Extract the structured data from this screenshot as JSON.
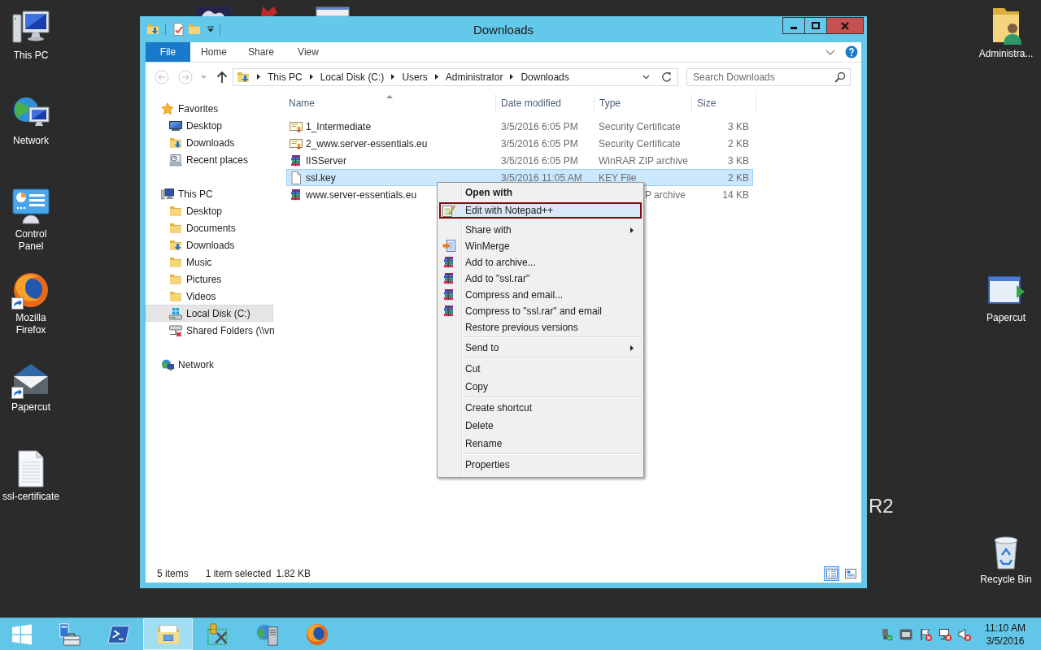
{
  "desktop": {
    "left_icons": [
      {
        "label": "This PC",
        "kind": "computer",
        "shortcut": false
      },
      {
        "label": "Network",
        "kind": "network",
        "shortcut": false
      },
      {
        "label": "Control Panel",
        "kind": "control-panel",
        "shortcut": false
      },
      {
        "label": "Mozilla Firefox",
        "kind": "browser",
        "shortcut": true
      },
      {
        "label": "Papercut",
        "kind": "mail",
        "shortcut": true
      },
      {
        "label": "ssl-certificate",
        "kind": "document",
        "shortcut": false
      }
    ],
    "right_icons": [
      {
        "label": "Administra...",
        "kind": "user-folder",
        "shortcut": false
      },
      {
        "label": "Papercut",
        "kind": "app-window",
        "shortcut": false
      },
      {
        "label": "Recycle Bin",
        "kind": "recycle-bin",
        "shortcut": false
      }
    ],
    "edition_text": "R2"
  },
  "window": {
    "title": "Downloads",
    "ribbon_tabs": [
      {
        "label": "File",
        "kind": "file",
        "selected": false
      },
      {
        "label": "Home",
        "kind": "tab",
        "selected": false
      },
      {
        "label": "Share",
        "kind": "tab",
        "selected": false
      },
      {
        "label": "View",
        "kind": "tab",
        "selected": false
      }
    ],
    "address": {
      "crumbs": [
        "This PC",
        "Local Disk (C:)",
        "Users",
        "Administrator",
        "Downloads"
      ]
    },
    "search": {
      "placeholder": "Search Downloads"
    },
    "nav": [
      {
        "label": "Favorites",
        "kind": "star",
        "selected": false,
        "children": [
          {
            "label": "Desktop",
            "kind": "monitor",
            "selected": false
          },
          {
            "label": "Downloads",
            "kind": "download-folder",
            "selected": false
          },
          {
            "label": "Recent places",
            "kind": "recent",
            "selected": false
          }
        ]
      },
      {
        "label": "This PC",
        "kind": "computer",
        "selected": false,
        "children": [
          {
            "label": "Desktop",
            "kind": "folder",
            "selected": false
          },
          {
            "label": "Documents",
            "kind": "folder",
            "selected": false
          },
          {
            "label": "Downloads",
            "kind": "download-folder",
            "selected": false
          },
          {
            "label": "Music",
            "kind": "folder",
            "selected": false
          },
          {
            "label": "Pictures",
            "kind": "folder",
            "selected": false
          },
          {
            "label": "Videos",
            "kind": "folder",
            "selected": false
          },
          {
            "label": "Local Disk (C:)",
            "kind": "drive",
            "selected": true
          },
          {
            "label": "Shared Folders (\\\\vn",
            "kind": "network-drive",
            "selected": false
          }
        ]
      },
      {
        "label": "Network",
        "kind": "network",
        "selected": false
      }
    ],
    "columns": [
      {
        "label": "Name",
        "sorted": true
      },
      {
        "label": "Date modified",
        "sorted": false
      },
      {
        "label": "Type",
        "sorted": false
      },
      {
        "label": "Size",
        "sorted": false
      }
    ],
    "files": [
      {
        "name": "1_Intermediate",
        "date": "3/5/2016 6:05 PM",
        "type": "Security Certificate",
        "size": "3 KB",
        "kind": "certificate",
        "selected": false,
        "covered": false
      },
      {
        "name": "2_www.server-essentials.eu",
        "date": "3/5/2016 6:05 PM",
        "type": "Security Certificate",
        "size": "2 KB",
        "kind": "certificate",
        "selected": false,
        "covered": false
      },
      {
        "name": "IISServer",
        "date": "3/5/2016 6:05 PM",
        "type": "WinRAR ZIP archive",
        "size": "3 KB",
        "kind": "archive",
        "selected": false,
        "covered": false
      },
      {
        "name": "ssl.key",
        "date": "3/5/2016 11:05 AM",
        "type": "KEY File",
        "size": "2 KB",
        "kind": "file",
        "selected": true,
        "covered": false
      },
      {
        "name": "www.server-essentials.eu",
        "type": "P archive",
        "size": "14 KB",
        "kind": "archive",
        "selected": false,
        "covered": true
      }
    ],
    "status": {
      "count": "5 items",
      "selection": "1 item selected",
      "size": "1.82 KB"
    },
    "view_buttons": [
      {
        "kind": "details",
        "selected": true
      },
      {
        "kind": "tiles",
        "selected": false
      }
    ]
  },
  "context_menu": {
    "groups": [
      [
        {
          "label": "Open with",
          "kind": "plain",
          "bold": true,
          "submenu": false,
          "selected": false
        },
        {
          "label": "Edit with Notepad++",
          "kind": "notepad",
          "bold": false,
          "submenu": false,
          "selected": true
        },
        {
          "label": "Share with",
          "kind": "plain",
          "bold": false,
          "submenu": true,
          "selected": false
        },
        {
          "label": "WinMerge",
          "kind": "winmerge",
          "bold": false,
          "submenu": false,
          "selected": false
        },
        {
          "label": "Add to archive...",
          "kind": "archive",
          "bold": false,
          "submenu": false,
          "selected": false
        },
        {
          "label": "Add to \"ssl.rar\"",
          "kind": "archive",
          "bold": false,
          "submenu": false,
          "selected": false
        },
        {
          "label": "Compress and email...",
          "kind": "archive",
          "bold": false,
          "submenu": false,
          "selected": false
        },
        {
          "label": "Compress to \"ssl.rar\" and email",
          "kind": "archive",
          "bold": false,
          "submenu": false,
          "selected": false
        },
        {
          "label": "Restore previous versions",
          "kind": "plain",
          "bold": false,
          "submenu": false,
          "selected": false
        }
      ],
      [
        {
          "label": "Send to",
          "kind": "plain",
          "bold": false,
          "submenu": true,
          "selected": false
        }
      ],
      [
        {
          "label": "Cut",
          "kind": "plain",
          "bold": false,
          "submenu": false,
          "selected": false
        },
        {
          "label": "Copy",
          "kind": "plain",
          "bold": false,
          "submenu": false,
          "selected": false
        }
      ],
      [
        {
          "label": "Create shortcut",
          "kind": "plain",
          "bold": false,
          "submenu": false,
          "selected": false
        },
        {
          "label": "Delete",
          "kind": "plain",
          "bold": false,
          "submenu": false,
          "selected": false
        },
        {
          "label": "Rename",
          "kind": "plain",
          "bold": false,
          "submenu": false,
          "selected": false
        }
      ],
      [
        {
          "label": "Properties",
          "kind": "plain",
          "bold": false,
          "submenu": false,
          "selected": false
        }
      ]
    ]
  },
  "taskbar": {
    "apps": [
      {
        "kind": "server-manager",
        "selected": false
      },
      {
        "kind": "terminal",
        "selected": false
      },
      {
        "kind": "file-explorer",
        "selected": true
      },
      {
        "kind": "tools",
        "selected": false
      },
      {
        "kind": "server",
        "selected": false
      },
      {
        "kind": "browser",
        "selected": false
      }
    ],
    "tray": [
      {
        "kind": "usb",
        "alert": false
      },
      {
        "kind": "vm",
        "alert": false
      },
      {
        "kind": "flag",
        "alert": true
      },
      {
        "kind": "network",
        "alert": true
      },
      {
        "kind": "speaker",
        "alert": true
      }
    ],
    "clock": {
      "time": "11:10 AM",
      "date": "3/5/2016"
    }
  }
}
